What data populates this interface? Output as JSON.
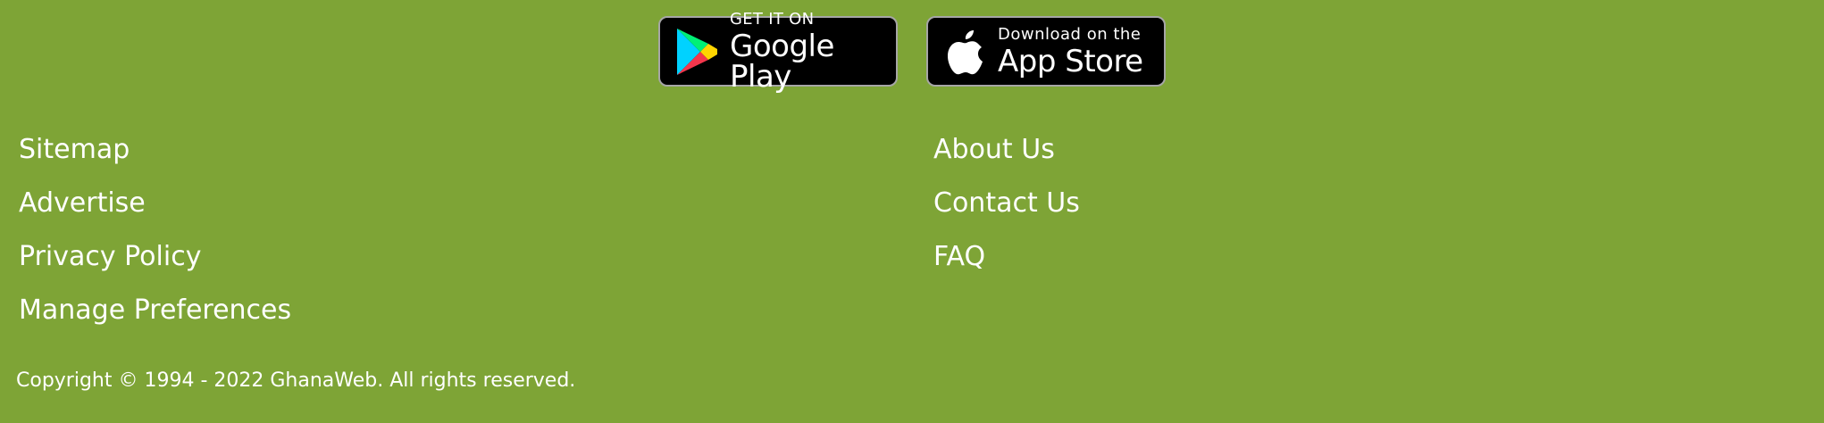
{
  "app_badges": {
    "google_play": {
      "small_text": "GET IT ON",
      "big_text": "Google Play",
      "icon": "google-play-icon"
    },
    "app_store": {
      "small_text": "Download on the",
      "big_text": "App Store",
      "icon": "apple-icon"
    }
  },
  "footer": {
    "links_left": [
      "Sitemap",
      "Advertise",
      "Privacy Policy",
      "Manage Preferences"
    ],
    "links_right": [
      "About Us",
      "Contact Us",
      "FAQ"
    ],
    "copyright": "Copyright © 1994 - 2022 GhanaWeb. All rights reserved."
  },
  "colors": {
    "background": "#7ea436",
    "text": "#ffffff",
    "badge_background": "#000000",
    "badge_border": "#a6a6a6"
  }
}
